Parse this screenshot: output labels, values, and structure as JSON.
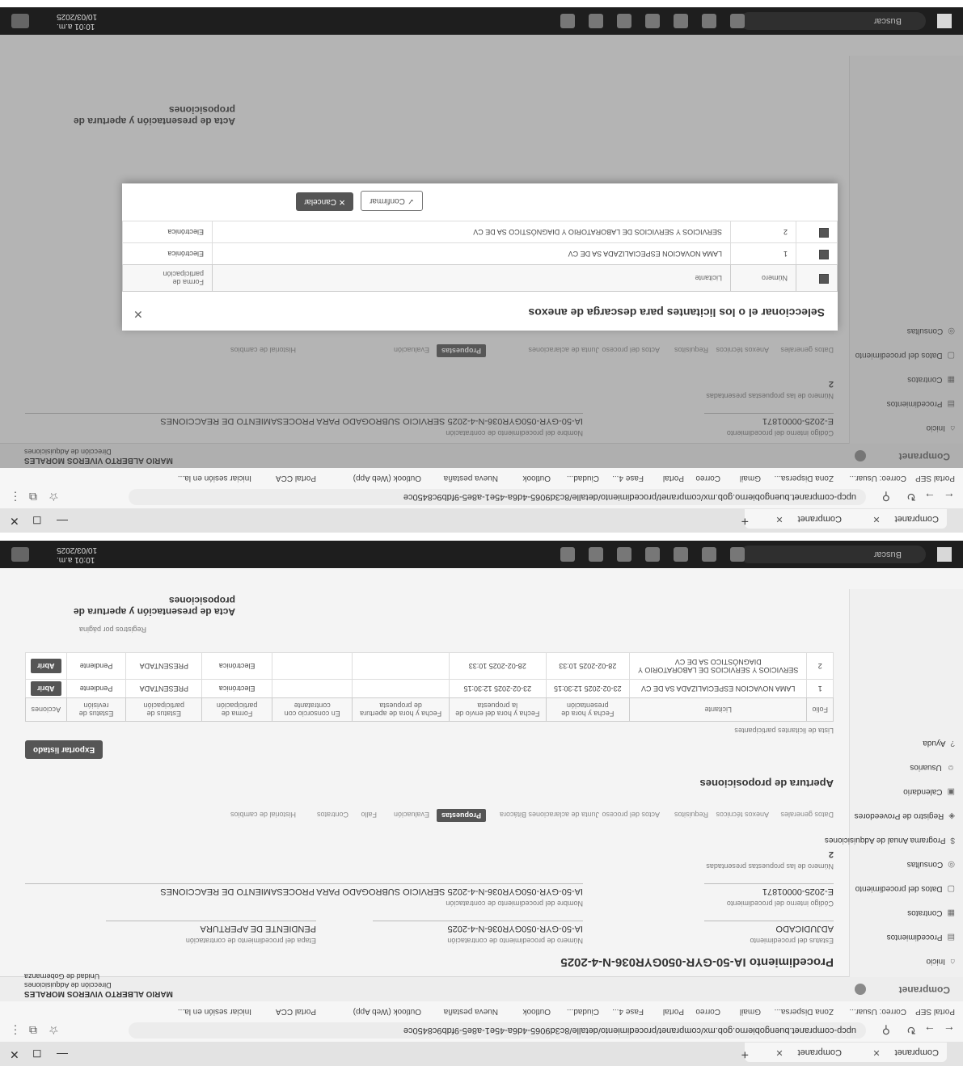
{
  "browser": {
    "tabs": [
      {
        "label": "Compranet"
      },
      {
        "label": "Compranet"
      }
    ],
    "url": "upcp-compranet.buengobierno.gob.mx/compranet/procedimiento/detalle/8c3d9065-4d6a-45e1-a8e5-9fdb9c8450ce",
    "bookmarks": [
      "Portal SEP",
      "Correo: Usuar...",
      "Zona Dispersa...",
      "Gmail",
      "Correo",
      "Portal",
      "Fase 4...",
      "Ciudad...",
      "Outlook",
      "Nueva pestaña",
      "Outlook (Web App)",
      "Portal CCA",
      "Iniciar sesión en la..."
    ]
  },
  "app": {
    "logo": "Compranet",
    "user_name": "MARIO ALBERTO VIVEROS MORALES",
    "user_role": "Dirección de Adquisiciones",
    "user_unit": "Unidad de Gobernanza"
  },
  "sidebar": {
    "items": [
      {
        "icon": "home-icon",
        "label": "Inicio"
      },
      {
        "icon": "procedures-icon",
        "label": "Procedimientos"
      },
      {
        "icon": "contracts-icon",
        "label": "Contratos"
      },
      {
        "icon": "docs-icon",
        "label": "Datos del procedimiento"
      },
      {
        "icon": "consult-icon",
        "label": "Consultas"
      },
      {
        "icon": "finance-icon",
        "label": "Programa Anual de Adquisiciones"
      },
      {
        "icon": "supplier-icon",
        "label": "Registro de Proveedores"
      },
      {
        "icon": "calendar-icon",
        "label": "Calendario"
      },
      {
        "icon": "user-icon",
        "label": "Usuarios"
      },
      {
        "icon": "help-icon",
        "label": "Ayuda"
      }
    ]
  },
  "procedure": {
    "heading": "Procedimiento IA-50-GYR-050GYR036-N-4-2025",
    "status_label": "Estatus del procedimiento",
    "status_value": "ADJUDICADO",
    "number_label": "Número de procedimiento de contratación",
    "number_value": "IA-50-GYR-050GYR036-N-4-2025",
    "stage_label": "Etapa del procedimiento de contratación",
    "stage_value": "PENDIENTE DE APERTURA",
    "code_label": "Código interno del procedimiento",
    "code_value": "E-2025-00001871",
    "name_label": "Nombre del procedimiento de contratación",
    "name_value": "IA-50-GYR-050GYR036-N-4-2025 SERVICIO SUBROGADO PARA PROCESAMIENTO DE REACCIONES",
    "count_label": "Número de las propuestas presentadas",
    "count_value": "2"
  },
  "section_tabs": [
    "Datos generales",
    "Anexos técnicos",
    "Requisitos",
    "Actos del proceso",
    "Junta de aclaraciones",
    "Bitácora",
    "Propuestas",
    "Evaluación",
    "Fallo",
    "Contratos",
    "Historial de cambios"
  ],
  "active_tab": "Propuestas",
  "proposals": {
    "heading": "Apertura de proposiciones",
    "export_button": "Exportar listado",
    "list_title": "Lista de licitantes participantes",
    "columns": [
      "Folio",
      "Licitante",
      "Fecha y hora de presentación",
      "Fecha y hora del envío de la propuesta",
      "Fecha y hora de apertura de propuesta",
      "En consorcio con contratante",
      "Forma de participación",
      "Estatus de participación",
      "Estatus de revisión",
      "Acciones"
    ],
    "rows": [
      {
        "folio": "1",
        "licitante": "LAMA NOVACION ESPECIALIZADA SA DE CV",
        "fecha_presentacion": "23-02-2025 12:30:15",
        "fecha_envio": "23-02-2025 12:30:15",
        "fecha_apertura": "",
        "consorcio": "",
        "forma": "Electrónica",
        "estatus": "PRESENTADA",
        "revision": "Pendiente",
        "accion": "Abrir"
      },
      {
        "folio": "2",
        "licitante": "SERVICIOS Y SERVICIOS DE LABORATORIO Y DIAGNÓSTICO SA DE CV",
        "fecha_presentacion": "28-02-2025 10:33",
        "fecha_envio": "28-02-2025 10:33",
        "fecha_apertura": "",
        "consorcio": "",
        "forma": "Electrónica",
        "estatus": "PRESENTADA",
        "revision": "Pendiente",
        "accion": "Abrir"
      }
    ],
    "pagination_label": "Registros por página",
    "act_heading": "Acta de presentación y apertura de proposiciones"
  },
  "modal": {
    "title": "Seleccionar el o los licitantes para descarga de anexos",
    "columns": [
      "Número",
      "Licitante",
      "Forma de participación"
    ],
    "rows": [
      {
        "num": "1",
        "name": "LAMA NOVACION ESPECIALIZADA SA DE CV",
        "forma": "Electrónica"
      },
      {
        "num": "2",
        "name": "SERVICIOS Y SERVICIOS DE LABORATORIO Y DIAGNÓSTICO SA DE CV",
        "forma": "Electrónica"
      }
    ],
    "cancel": "Cancelar",
    "confirm": "Confirmar"
  },
  "taskbar": {
    "search": "Buscar",
    "time": "10:01 a.m.",
    "date": "10/03/2025"
  }
}
